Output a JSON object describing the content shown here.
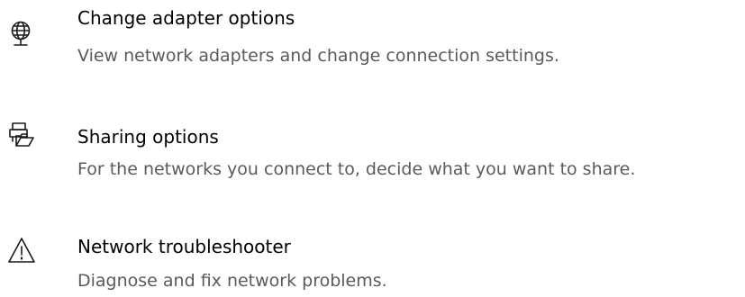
{
  "items": [
    {
      "icon": "network-adapter-icon",
      "title": "Change adapter options",
      "description": "View network adapters and change connection settings."
    },
    {
      "icon": "sharing-icon",
      "title": "Sharing options",
      "description": "For the networks you connect to, decide what you want to share."
    },
    {
      "icon": "warning-icon",
      "title": "Network troubleshooter",
      "description": "Diagnose and fix network problems."
    }
  ],
  "colors": {
    "title": "#000000",
    "description": "#5a5a5a",
    "icon": "#1a1a1a"
  }
}
